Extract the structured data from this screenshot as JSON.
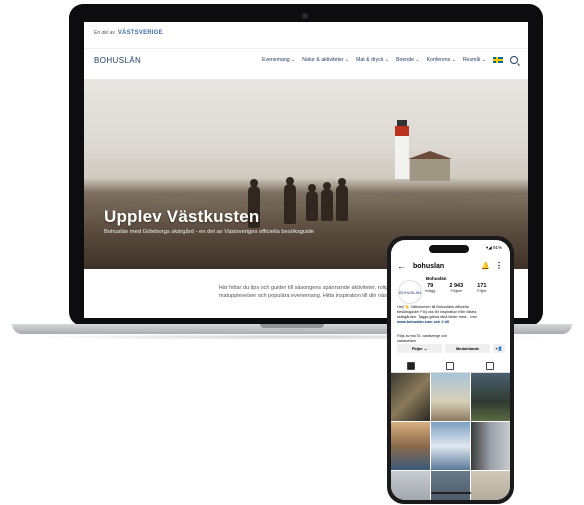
{
  "site": {
    "topbar_prefix": "En del av",
    "topbar_logo": "VÄSTSVERIGE",
    "brand": "BOHUSLÄN",
    "menu": [
      "Evenemang",
      "Natur & aktiviteter",
      "Mat & dryck",
      "Boende",
      "Konferens",
      "Resmål"
    ],
    "hero_title": "Upplev Västkusten",
    "hero_subtitle": "Bohuslän med Göteborgs skärgård - en del av Västsveriges officiella besöksguide",
    "intro_line1": "Här hittar du tips och guider till säsongens spännande aktiviteter, roliga sevärd",
    "intro_line2": "matupplevelser och populära evenemang. Hitta inspiration till din nästa upplev"
  },
  "phone": {
    "time": "",
    "status": "▾◢ 91%",
    "username": "bohuslan",
    "avatar_text": "BOHUSLÄN",
    "profile_name": "Bohuslän",
    "stats": [
      {
        "num": "79",
        "lbl": "Inlägg"
      },
      {
        "num": "2 943",
        "lbl": "Följare"
      },
      {
        "num": "171",
        "lbl": "Följer"
      }
    ],
    "bio_line1": "Hej! 👋 Välkommen till Bohusläns officiella",
    "bio_line2": "besöksguide! Följ oss för inspiration från västra",
    "bio_line3": "skärgården. Tagga gärna dina bilder med... mer",
    "bio_link": "www.bohuslan.com och 2 till",
    "followed_by": "Följs av mio75, vastsverige och",
    "followed_by2": "vastsweden",
    "follow_btn": "Följer ⌄",
    "message_btn": "Meddelande",
    "add_btn": "+👤"
  }
}
